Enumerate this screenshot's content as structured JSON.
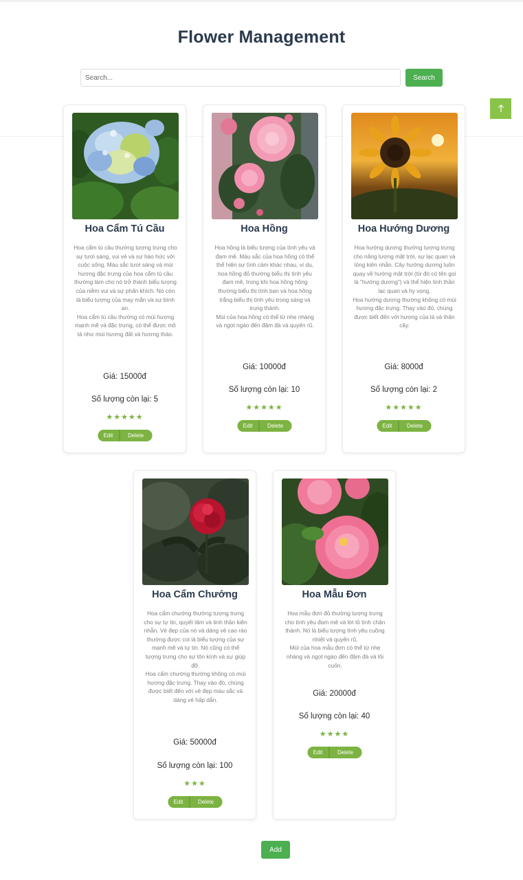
{
  "page": {
    "title": "Flower Management"
  },
  "search": {
    "placeholder": "Search...",
    "value": "",
    "button_label": "Search"
  },
  "scroll_top": {
    "icon": "arrow-up-icon",
    "glyph": "↑"
  },
  "colors": {
    "primary_green": "#4caf50",
    "accent_green": "#7cb342",
    "title": "#2b3a4d"
  },
  "flowers": [
    {
      "name": "Hoa Cẩm Tú Cầu",
      "description": "Hoa cẩm tú cầu thường tượng trưng cho sự tươi sáng, vui vẻ và sự háo hức với cuộc sống. Màu sắc tươi sáng và mùi hương đặc trưng của hoa cẩm tú cầu thường làm cho nó trở thành biểu tượng của niềm vui và sự phấn khích. Nó còn là biểu tượng của may mắn và sự bình an.\nHoa cẩm tú cầu thường có mùi hương mạnh mẽ và đặc trưng, có thể được mô tả như mùi hương đất và hương thảo.",
      "price": "Giá: 15000đ",
      "quantity": "Số lượng còn lại: 5",
      "rating": 5,
      "stars": "★★★★★",
      "image": "hydrangea-image",
      "edit_label": "Edit",
      "delete_label": "Delete"
    },
    {
      "name": "Hoa Hồng",
      "description": "Hoa hồng là biểu tượng của tình yêu và đam mê. Màu sắc của hoa hồng có thể thể hiện sự tình cảm khác nhau, ví dụ, hoa hồng đỏ thường biểu thị tình yêu đam mê, trong khi hoa hồng hồng thường biểu thị tình bạn và hoa hồng trắng biểu thị tình yêu trong sáng và trung thành.\nMùi của hoa hồng có thể từ nhẹ nhàng và ngọt ngào đến đậm đà và quyến rũ.",
      "price": "Giá: 10000đ",
      "quantity": "Số lượng còn lại: 10",
      "rating": 5,
      "stars": "★★★★★",
      "image": "rose-image",
      "edit_label": "Edit",
      "delete_label": "Delete"
    },
    {
      "name": "Hoa Hướng Dương",
      "description": "Hoa hướng dương thường tượng trưng cho năng lượng mặt trời, sự lạc quan và lòng kiên nhẫn. Cây hướng dương luôn quay về hướng mặt trời (từ đó có tên gọi là \"hướng dương\") và thể hiện tinh thần lạc quan và hy vọng.\nHoa hướng dương thường không có mùi hương đặc trưng. Thay vào đó, chúng được biết đến với hương của lá và thân cây.",
      "price": "Giá: 8000đ",
      "quantity": "Số lượng còn lại: 2",
      "rating": 5,
      "stars": "★★★★★",
      "image": "sunflower-image",
      "edit_label": "Edit",
      "delete_label": "Delete"
    },
    {
      "name": "Hoa Cẩm Chướng",
      "description": "Hoa cẩm chướng thường tượng trưng cho sự tự tin, quyết tâm và tinh thần kiên nhẫn. Vẻ đẹp của nó và dáng vẻ cao ráo thường được coi là biểu tượng của sự mạnh mẽ và tự tin. Nó cũng có thể tượng trưng cho sự tôn kính và sự giúp đỡ.\nHoa cẩm chướng thường không có mùi hương đặc trưng. Thay vào đó, chúng được biết đến với vẻ đẹp màu sắc và dáng vẻ hấp dẫn.",
      "price": "Giá: 50000đ",
      "quantity": "Số lượng còn lại: 100",
      "rating": 3,
      "stars": "★★★",
      "image": "carnation-image",
      "edit_label": "Edit",
      "delete_label": "Delete"
    },
    {
      "name": "Hoa Mẫu Đơn",
      "description": "Hoa mẫu đơn đỏ thường tượng trưng cho tình yêu đam mê và lời tỏ tình chân thành. Nó là biểu tượng tình yêu cuồng nhiệt và quyến rũ.\nMùi của hoa mẫu đơn có thể từ nhẹ nhàng và ngọt ngào đến đậm đà và lôi cuốn.",
      "price": "Giá: 20000đ",
      "quantity": "Số lượng còn lại: 40",
      "rating": 4,
      "stars": "★★★★",
      "image": "peony-image",
      "edit_label": "Edit",
      "delete_label": "Delete"
    }
  ],
  "add_button_label": "Add"
}
